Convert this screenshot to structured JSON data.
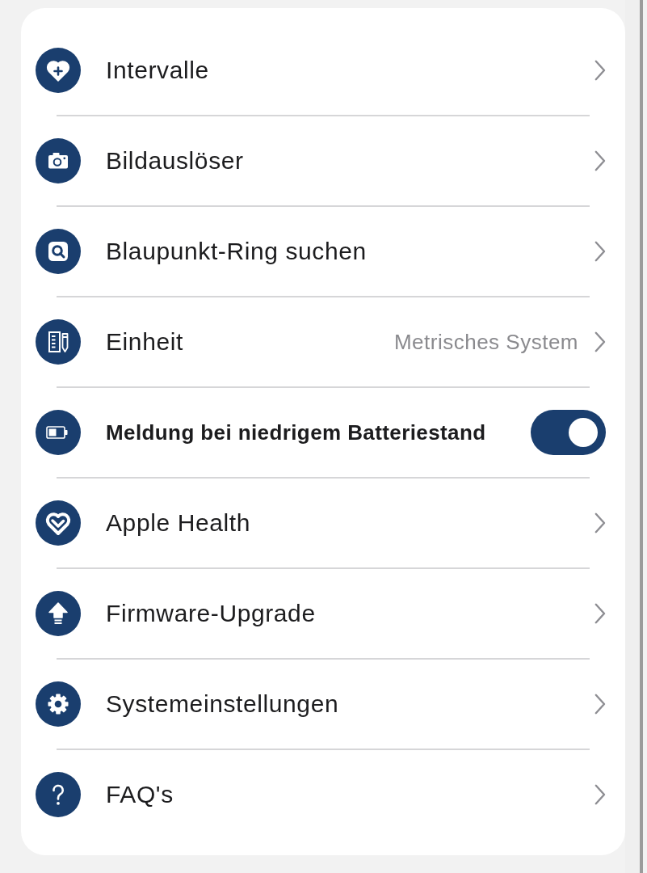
{
  "settings": {
    "items": [
      {
        "kind": "link",
        "label": "Intervalle"
      },
      {
        "kind": "link",
        "label": "Bildauslöser"
      },
      {
        "kind": "link",
        "label": "Blaupunkt-Ring suchen"
      },
      {
        "kind": "value",
        "label": "Einheit",
        "value": "Metrisches System"
      },
      {
        "kind": "toggle",
        "label": "Meldung bei niedrigem Batteriestand",
        "on": true
      },
      {
        "kind": "link",
        "label": "Apple Health"
      },
      {
        "kind": "link",
        "label": "Firmware-Upgrade"
      },
      {
        "kind": "link",
        "label": "Systemeinstellungen"
      },
      {
        "kind": "link",
        "label": "FAQ's"
      }
    ]
  }
}
